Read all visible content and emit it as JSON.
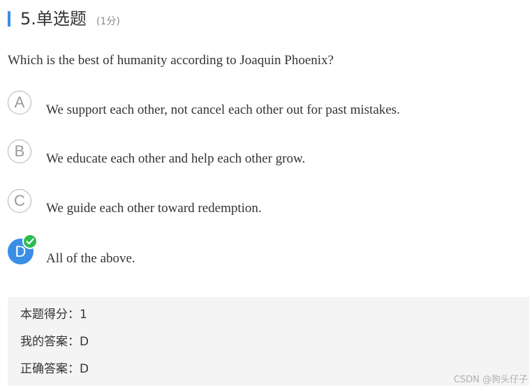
{
  "question": {
    "number_type": "5.单选题",
    "score": "(1分)",
    "text": "Which is the best of humanity according to Joaquin Phoenix?"
  },
  "options": [
    {
      "letter": "A",
      "text": "We support each other, not cancel each other out for past mistakes.",
      "selected": false
    },
    {
      "letter": "B",
      "text": "We educate each other and help each other grow.",
      "selected": false
    },
    {
      "letter": "C",
      "text": "We guide each other toward redemption.",
      "selected": false
    },
    {
      "letter": "D",
      "text": "All of the above.",
      "selected": true
    }
  ],
  "result": {
    "score_label": "本题得分：",
    "score_value": "1",
    "my_answer_label": "我的答案：",
    "my_answer_value": "D",
    "correct_answer_label": "正确答案：",
    "correct_answer_value": "D"
  },
  "watermark": "CSDN @狗头仔子",
  "colors": {
    "accent": "#3a8ee6",
    "correct": "#2dbb4f",
    "panel_bg": "#f4f4f4"
  },
  "icons": {
    "check": "check-icon"
  }
}
